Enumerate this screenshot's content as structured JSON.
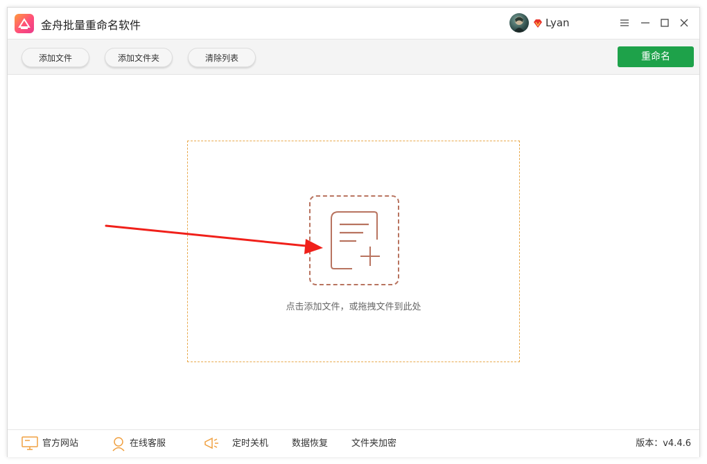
{
  "window": {
    "title": "金舟批量重命名软件",
    "user_name": "Lyan"
  },
  "toolbar": {
    "add_file_label": "添加文件",
    "add_folder_label": "添加文件夹",
    "clear_list_label": "清除列表",
    "rename_label": "重命名"
  },
  "main": {
    "drop_hint": "点击添加文件，或拖拽文件到此处"
  },
  "footer": {
    "official_site": "官方网站",
    "online_support": "在线客服",
    "timed_shutdown": "定时关机",
    "data_recovery": "数据恢复",
    "folder_encrypt": "文件夹加密",
    "version": "版本：v4.4.6"
  },
  "colors": {
    "accent_green": "#1ea24a",
    "drop_border": "#e8a84a",
    "icon_brown": "#b8735f",
    "footer_icon": "#f0a040",
    "arrow_red": "#f0201a"
  }
}
